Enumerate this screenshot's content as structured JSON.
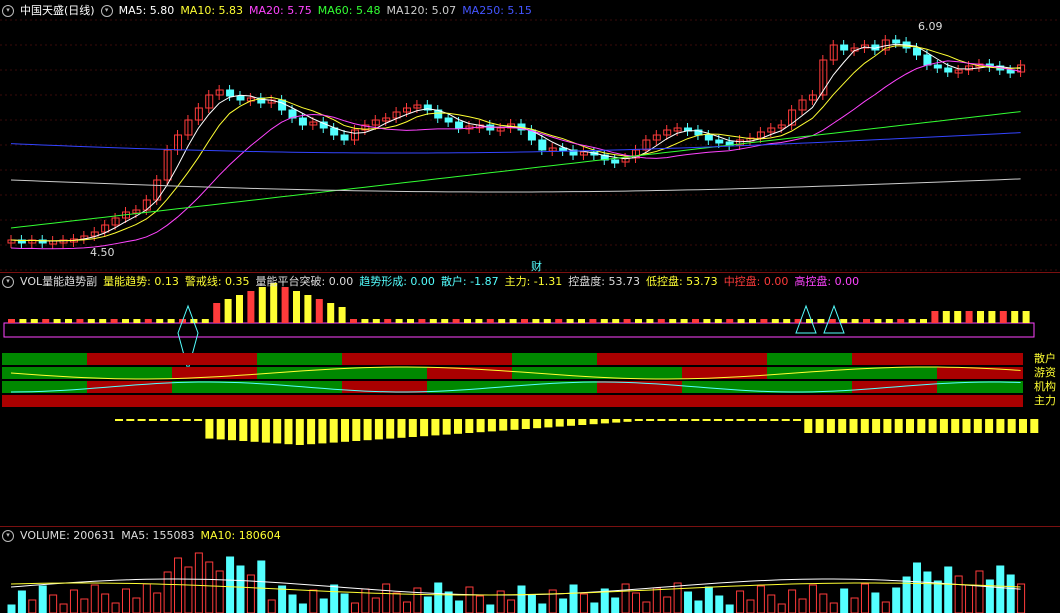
{
  "main_header": {
    "title": "中国天盛(日线)",
    "ma5": "MA5: 5.80",
    "ma10": "MA10: 5.83",
    "ma20": "MA20: 5.75",
    "ma60": "MA60: 5.48",
    "ma120": "MA120: 5.07",
    "ma250": "MA250: 5.15"
  },
  "main_annotations": {
    "high_price": "6.09",
    "low_price": "4.50",
    "finance_marker": "财"
  },
  "indicator_header": {
    "name": "VOL量能趋势副",
    "energy_trend": "量能趋势: 0.13",
    "alert_line": "警戒线: 0.35",
    "platform_break": "量能平台突破: 0.00",
    "trend_forming": "趋势形成: 0.00",
    "retail": "散户: -1.87",
    "main_force": "主力: -1.31",
    "control": "控盘度: 53.73",
    "low_control": "低控盘: 53.73",
    "mid_control": "中控盘: 0.00",
    "high_control": "高控盘: 0.00"
  },
  "band_labels": [
    "散户",
    "游资",
    "机构",
    "主力"
  ],
  "volume_header": {
    "volume": "VOLUME: 200631",
    "ma5": "MA5: 155083",
    "ma10": "MA10: 180604"
  },
  "colors": {
    "up": "#ff3b3b",
    "down": "#54ffff",
    "ma5": "#ffffff",
    "ma10": "#ffff33",
    "ma20": "#ff44ff",
    "ma60": "#33ff33",
    "ma120": "#cccccc",
    "ma250": "#3344ff"
  }
}
